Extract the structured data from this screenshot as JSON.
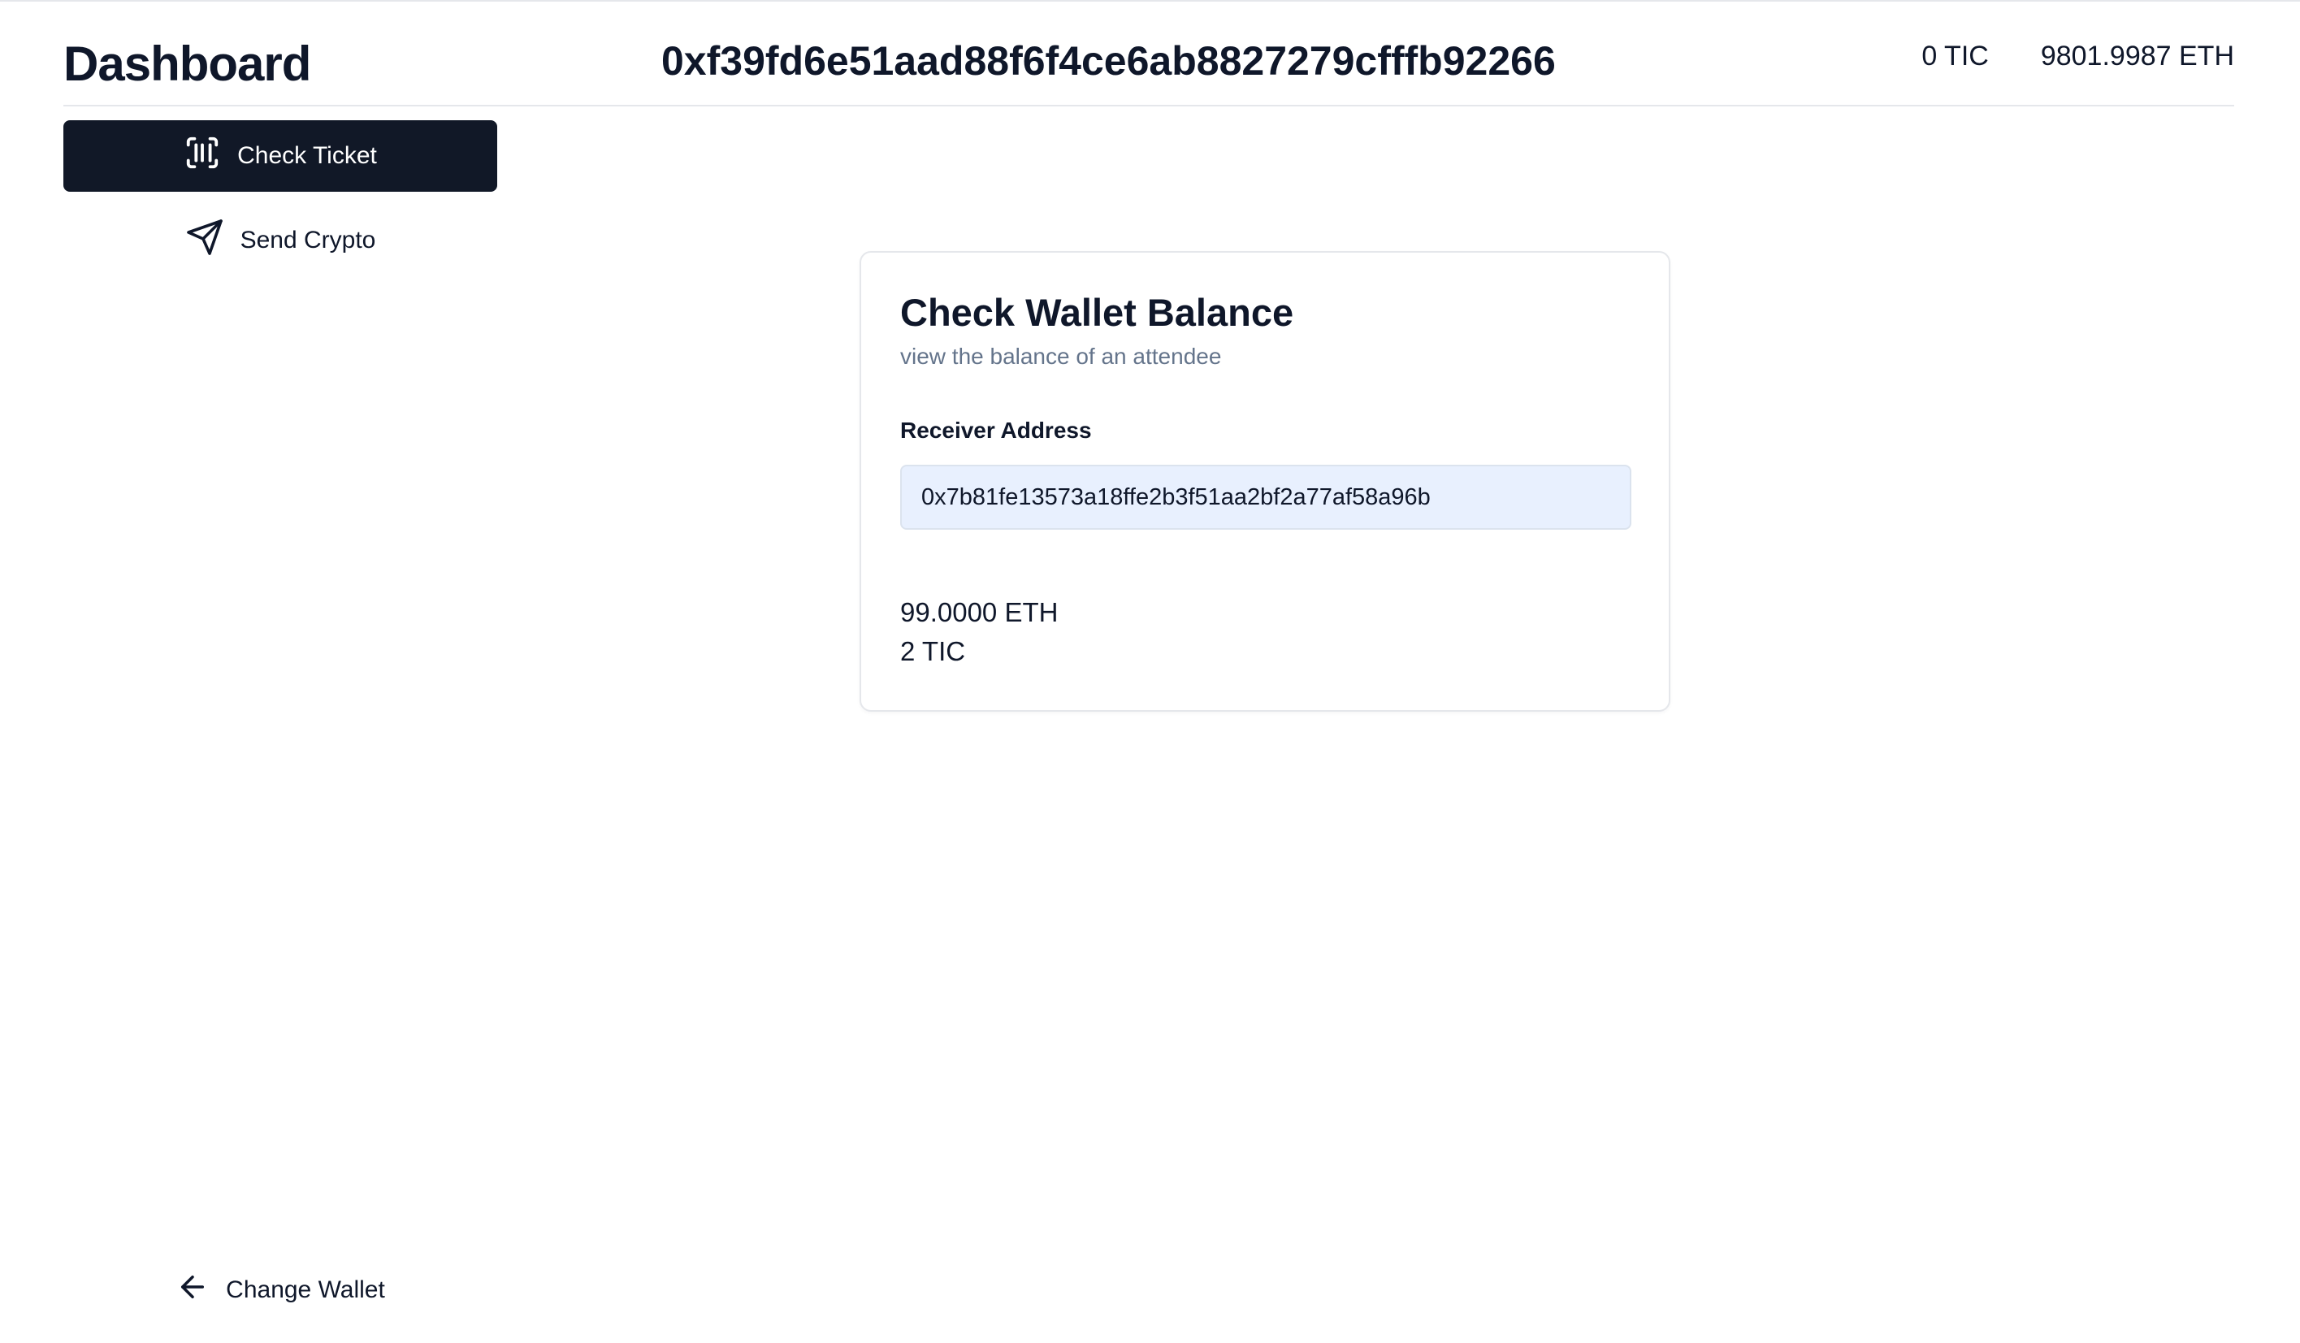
{
  "header": {
    "title": "Dashboard",
    "wallet_address": "0xf39fd6e51aad88f6f4ce6ab8827279cfffb92266",
    "tic_balance": "0 TIC",
    "eth_balance": "9801.9987 ETH"
  },
  "sidebar": {
    "items": [
      {
        "label": "Check Ticket",
        "icon": "scan-barcode-icon",
        "active": true
      },
      {
        "label": "Send Crypto",
        "icon": "send-icon",
        "active": false
      }
    ],
    "change_wallet": {
      "label": "Change Wallet",
      "icon": "arrow-left-icon"
    }
  },
  "card": {
    "title": "Check Wallet Balance",
    "subtitle": "view the balance of an attendee",
    "field_label": "Receiver Address",
    "address_value": "0x7b81fe13573a18ffe2b3f51aa2bf2a77af58a96b",
    "result_eth": "99.0000 ETH",
    "result_tic": "2 TIC"
  },
  "colors": {
    "primary": "#111827",
    "input_bg": "#e8f0fe",
    "muted_text": "#64748b",
    "border": "#e5e7eb"
  }
}
